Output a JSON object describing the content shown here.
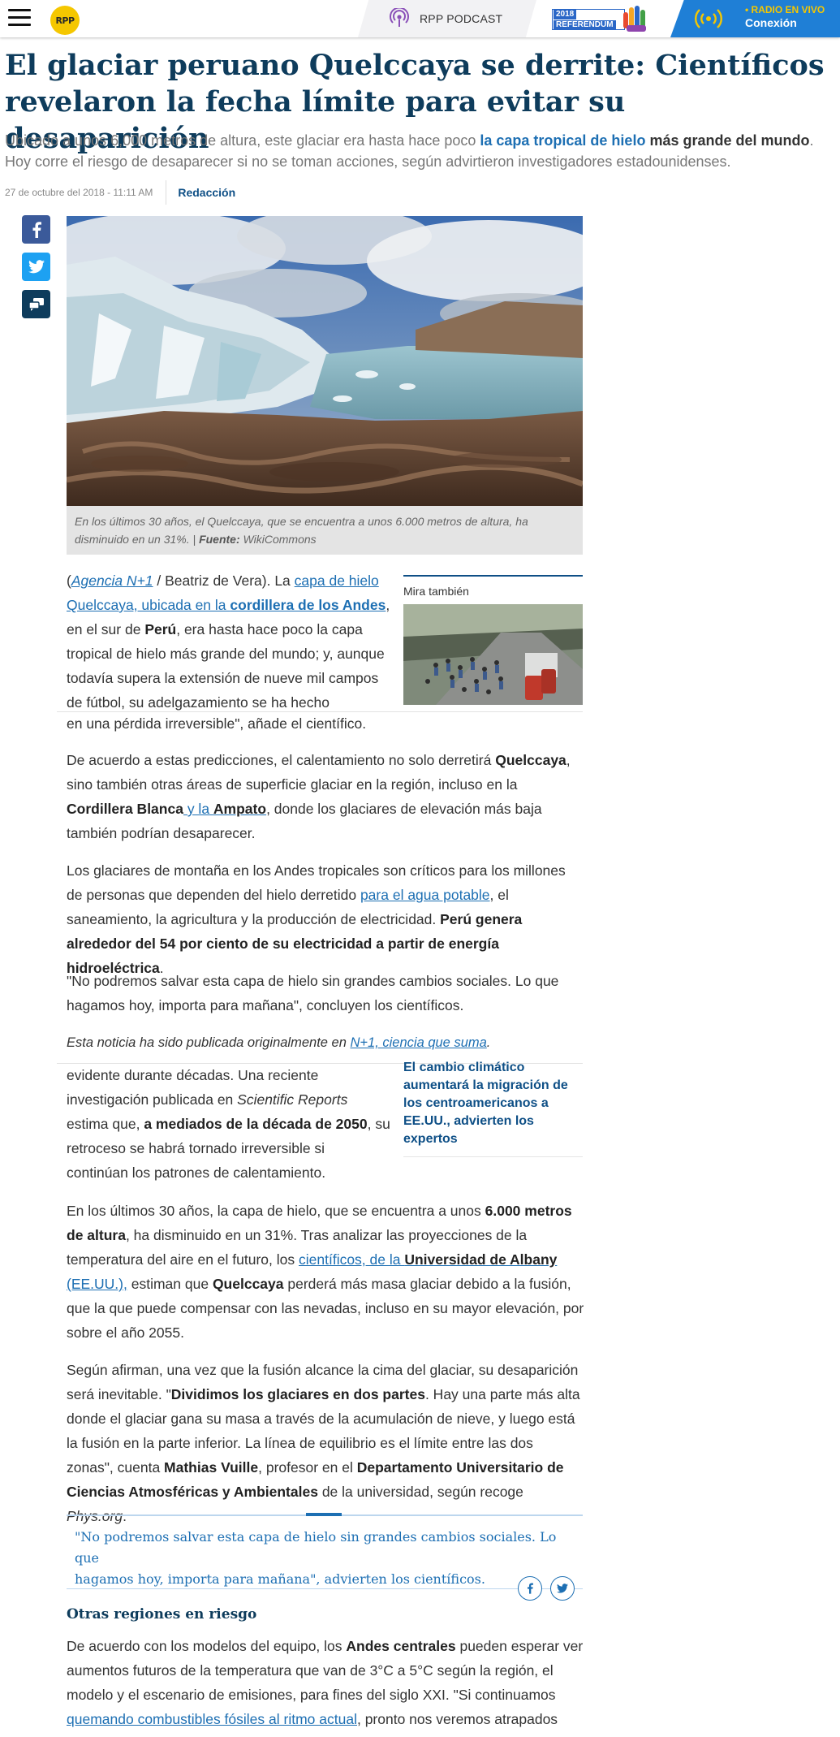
{
  "header": {
    "logo_text": "RPP",
    "podcast_label": "RPP PODCAST",
    "referendum_year": "2018",
    "referendum_label": "REFERÉNDUM",
    "radio_small": "• RADIO EN VIVO",
    "radio_big": "Conexión",
    "colors": {
      "accent_blue": "#1f7fd6",
      "logo_yellow": "#f5c700",
      "headline": "#0e3c5c"
    },
    "icons": [
      "menu-icon",
      "podcast-icon",
      "radio-signal-icon"
    ]
  },
  "article": {
    "title": "El glaciar peruano Quelccaya se derrite: Científicos revelaron la fecha límite para evitar su desaparición",
    "sub_pre": "Ubicado a unos 6,000 metros de altura, este glaciar era hasta hace poco ",
    "sub_hl1": "la capa tropical de hielo",
    "sub_hl2": " más grande del mundo",
    "sub_post": ". Hoy corre el riesgo de desaparecer si no se toman acciones, según advirtieron investigadores estadounidenses.",
    "date": "27 de octubre del 2018 - 11:11 AM",
    "author": "Redacción",
    "caption_text": "En los últimos 30 años, el Quelccaya, que se encuentra a unos 6.000 metros de altura, ha disminuido en un 31%. | ",
    "caption_source_label": "Fuente:",
    "caption_source": " WikiCommons"
  },
  "social": {
    "icons": [
      "facebook-icon",
      "twitter-icon",
      "comment-icon"
    ]
  },
  "p1": {
    "open": "(",
    "agency": "Agencia N+1",
    "agency_rest": " / Beatriz de Vera). La ",
    "l1": "capa de hielo",
    "l2": "Quelccaya, ubicada en la ",
    "l2b": "cordillera de los Andes",
    "t1": ",",
    "t2": "en el sur de ",
    "peru": "Perú",
    "t3": ", era hasta hace poco la capa",
    "t4": "tropical de hielo más grande del mundo; y, aunque",
    "t5": "todavía supera la extensión de nueve mil campos",
    "t6": "de fútbol, su adelgazamiento se ha hecho"
  },
  "mira": {
    "title": "Mira también",
    "card2_title": "El cambio climático aumentará la migración de los centroamericanos a EE.UU., advierten los expertos"
  },
  "p_frag1": "en una pérdida irreversible\", añade el científico.",
  "p2": {
    "a": "De acuerdo a estas predicciones, el calentamiento no solo derretirá ",
    "b": "Quelccaya",
    "c": ",",
    "d": "sino también otras áreas de superficie glaciar en la región, incluso en la",
    "e": "Cordillera Blanca",
    "f": " y la ",
    "g": "Ampato",
    "h": ", donde los glaciares de elevación más baja",
    "i": "también podrían desaparecer."
  },
  "p3": {
    "a": "Los glaciares de montaña en los Andes tropicales son críticos para los millones",
    "b": "de personas que dependen del hielo derretido ",
    "c": "para el agua potable",
    "d": ", el",
    "e": "saneamiento, la agricultura y la producción de electricidad. ",
    "f": "Perú genera",
    "g": "alrededor del 54 por ciento de su electricidad a partir de energía hidroeléctrica",
    "h": "."
  },
  "p4": {
    "a": "\"No podremos salvar esta capa de hielo sin grandes cambios sociales. Lo que",
    "b": "hagamos hoy, importa para mañana\", concluyen los científicos."
  },
  "p5": {
    "a": "Esta noticia ha sido publicada originalmente en ",
    "b": "N+1, ciencia que suma",
    "c": "."
  },
  "p6": {
    "a": "evidente durante décadas. Una reciente",
    "b": "investigación publicada en ",
    "c": "Scientific Reports",
    "d": "estima que, ",
    "e": "a mediados de la década de 2050",
    "f": ", su",
    "g": "retroceso se habrá tornado irreversible si",
    "h": "continúan los patrones de calentamiento."
  },
  "p7": {
    "a": "En los últimos 30 años, la capa de hielo, que se encuentra a unos ",
    "b": "6.000 metros",
    "c": "de altura",
    "d": ", ha disminuido en un 31%. Tras analizar las proyecciones de la",
    "e": "temperatura del aire en el futuro, los ",
    "f": "científicos, de la ",
    "g": "Universidad de Albany",
    "h": "(EE.UU.),",
    "i": " estiman que ",
    "j": "Quelccaya",
    "k": " perderá más masa glaciar debido a la fusión,",
    "l": "que la que puede compensar con las nevadas, incluso en su mayor elevación, por",
    "m": "sobre el año 2055."
  },
  "p8": {
    "a": "Según afirman, una vez que la fusión alcance la cima del glaciar, su desaparición",
    "b": "será inevitable. \"",
    "c": "Dividimos los glaciares en dos partes",
    "d": ". Hay una parte más alta",
    "e": "donde el glaciar gana su masa a través de la acumulación de nieve, y luego está",
    "f": "la fusión en la parte inferior. La línea de equilibrio es el límite entre las dos",
    "g": "zonas\", cuenta ",
    "h": "Mathias Vuille",
    "i": ", profesor en el ",
    "j": "Departamento Universitario de",
    "k": "Ciencias Atmosféricas y Ambientales",
    "l": " de la universidad, según recoge ",
    "m": "Phys.org",
    "n": "."
  },
  "quote": {
    "a": "\"No podremos salvar esta capa de hielo sin grandes cambios sociales. Lo que",
    "b": "hagamos hoy, importa para mañana\", advierten los científicos."
  },
  "section": {
    "title": "Otras regiones en riesgo"
  },
  "p9": {
    "a": "De acuerdo con los modelos del equipo, los ",
    "b": "Andes centrales",
    "c": " pueden esperar ver",
    "d": "aumentos futuros de la temperatura que van de 3°C a 5°C según la región, el",
    "e": "modelo y el escenario de emisiones, para fines del siglo XXI. \"Si continuamos",
    "f": "quemando combustibles fósiles al ritmo actual",
    "g": ", pronto nos veremos atrapados"
  }
}
